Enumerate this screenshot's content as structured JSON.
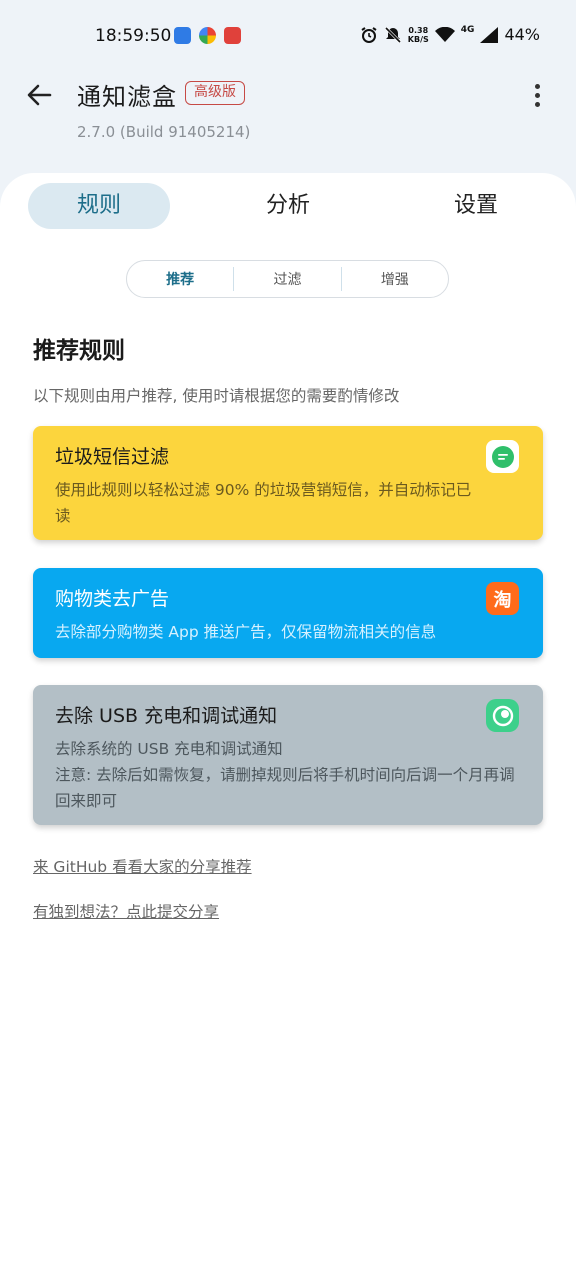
{
  "status_bar": {
    "time": "18:59:50",
    "net_speed_value": "0.38",
    "net_speed_unit": "KB/S",
    "network_type": "4G",
    "battery": "44%",
    "icons": [
      "alarm-icon",
      "mute-icon",
      "wifi-icon",
      "signal-icon"
    ]
  },
  "app_bar": {
    "title": "通知滤盒",
    "badge": "高级版",
    "version": "2.7.0  (Build 91405214)"
  },
  "tabs": [
    {
      "label": "规则",
      "active": true
    },
    {
      "label": "分析",
      "active": false
    },
    {
      "label": "设置",
      "active": false
    }
  ],
  "segments": [
    {
      "label": "推荐",
      "active": true
    },
    {
      "label": "过滤",
      "active": false
    },
    {
      "label": "增强",
      "active": false
    }
  ],
  "section": {
    "title": "推荐规则",
    "description": "以下规则由用户推荐, 使用时请根据您的需要酌情修改"
  },
  "cards": [
    {
      "title": "垃圾短信过滤",
      "body": "使用此规则以轻松过滤 90% 的垃圾营销短信，并自动标记已读",
      "color": "#fcd53d",
      "icon": "messages-app-icon"
    },
    {
      "title": "购物类去广告",
      "body": "去除部分购物类 App 推送广告，仅保留物流相关的信息",
      "color": "#08a8f0",
      "icon": "taobao-app-icon",
      "icon_text": "淘"
    },
    {
      "title": "去除 USB 充电和调试通知",
      "body": "去除系统的 USB 充电和调试通知\n注意: 去除后如需恢复，请删掉规则后将手机时间向后调一个月再调回来即可",
      "color": "#b3bfc6",
      "icon": "android-system-icon"
    }
  ],
  "links": {
    "github": "来 GitHub 看看大家的分享推荐",
    "share": "有独到想法？点此提交分享"
  },
  "colors": {
    "accent": "#1d6e8a",
    "active_tab_bg": "#dbe9f1",
    "badge": "#c64a45",
    "background": "#eef3f8"
  }
}
